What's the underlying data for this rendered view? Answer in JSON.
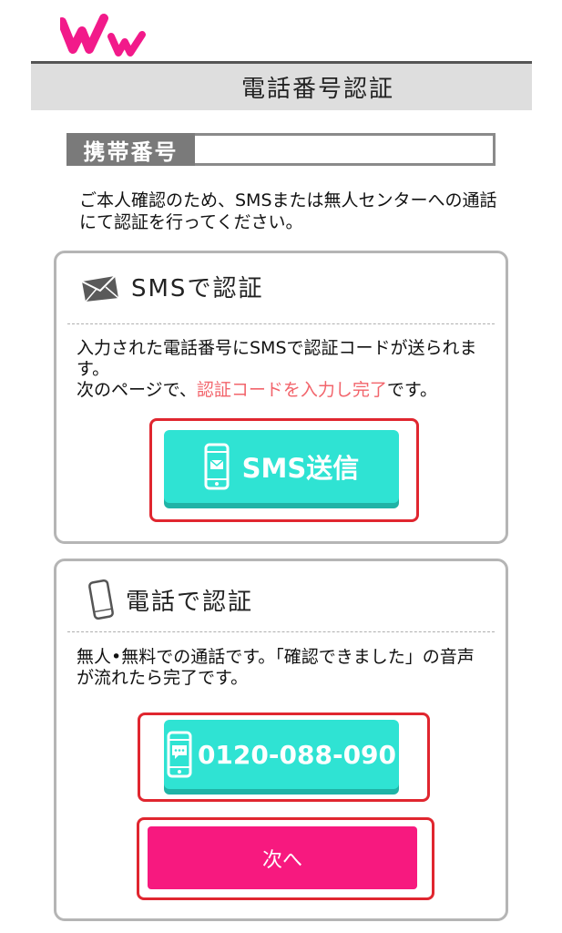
{
  "header": {
    "title": "電話番号認証"
  },
  "phone": {
    "label": "携帯番号",
    "value": "",
    "placeholder": ""
  },
  "intro": "ご本人確認のため、SMSまたは無人センターへの通話にて認証を行ってください。",
  "sms_card": {
    "title": "SMSで認証",
    "text_line1": "入力された電話番号にSMSで認証コードが送られます。",
    "text_prefix": "次のページで、",
    "text_highlight": "認証コードを入力し完了",
    "text_suffix": "です。",
    "button_label": "SMS送信"
  },
  "tel_card": {
    "title": "電話で認証",
    "text": "無人•無料での通話です。「確認できました」の音声が流れたら完了です。",
    "phone_button_label": "0120-088-090",
    "next_button_label": "次へ"
  },
  "colors": {
    "teal": "#2fe3d3",
    "pink": "#f7197f",
    "highlight": "#f2646b",
    "frame_red": "#e0262f",
    "logo": "#f21a8a"
  },
  "icons": [
    "logo-icon",
    "envelope-icon",
    "smartphone-mail-icon",
    "mobile-phone-icon",
    "smartphone-chat-icon"
  ]
}
